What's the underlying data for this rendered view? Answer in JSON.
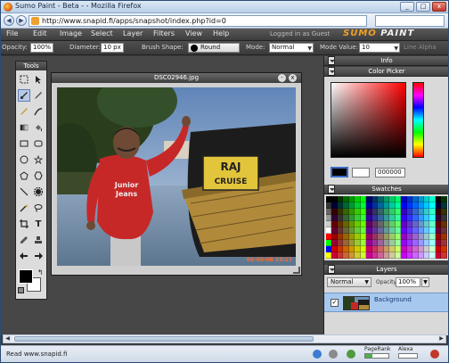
{
  "window": {
    "title": "Sumo Paint - Beta - - Mozilla Firefox",
    "minimize": "_",
    "maximize": "□",
    "close": "x"
  },
  "browser": {
    "url": "http://www.snapid.fi/apps/snapshot/index.php?id=0",
    "status_text": "Read www.snapid.fi",
    "pagerank_label": "PageRank",
    "alexa_label": "Alexa"
  },
  "menu": {
    "items": [
      "File",
      "Edit",
      "Image",
      "Select",
      "Layer",
      "Filters",
      "View",
      "Help"
    ],
    "login_status": "Logged in as Guest",
    "logo_sumo": "SUMO",
    "logo_paint": "PAINT"
  },
  "toolbar": {
    "opacity_label": "Opacity:",
    "opacity_value": "100%",
    "diameter_label": "Diameter:",
    "diameter_value": "10 px",
    "brush_shape_label": "Brush Shape:",
    "brush_shape_value": "Round",
    "mode_label": "Mode:",
    "mode_value": "Normal",
    "mode_value_label": "Mode Value:",
    "mode_value_value": "10",
    "line_alpha_label": "Line Alpha"
  },
  "tools_panel": {
    "title": "Tools",
    "text_tool_glyph": "T"
  },
  "document": {
    "title": "DSC02946.jpg",
    "boat_sign_line1": "RAJ",
    "boat_sign_line2": "CRUISE",
    "shirt_text_line1": "Junior",
    "shirt_text_line2": "Jeans",
    "photo_stamp": "06-05-08 15:17"
  },
  "panels": {
    "info_title": "Info",
    "color_picker_title": "Color Picker",
    "hex_value": "000000",
    "swatches_title": "Swatches",
    "layers_title": "Layers",
    "layer_mode": "Normal",
    "layer_opacity_label": "Opacity:",
    "layer_opacity_value": "100%",
    "layer_name": "Background"
  },
  "colors": {
    "foreground": "#000000",
    "background": "#ffffff",
    "hue_indicator": "#ff0000",
    "selected_layer": "#a7c8ee"
  }
}
